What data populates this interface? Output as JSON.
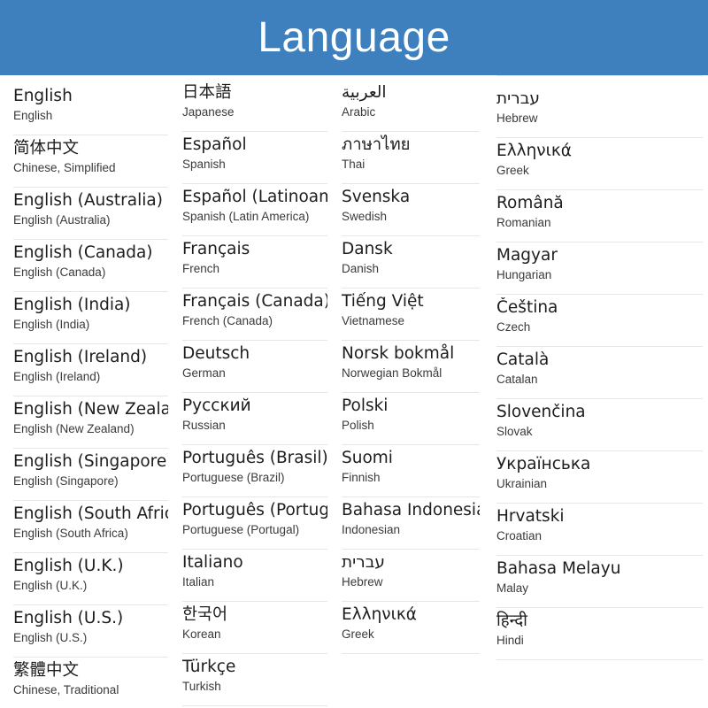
{
  "header": {
    "title": "Language",
    "background_color": "#3d80bd",
    "text_color": "#ffffff"
  },
  "theme": {
    "accent": "#3d80bd",
    "divider": "#e6e6e6",
    "native_text": "#1d1d1d",
    "english_text": "#3a3a3a",
    "page_background": "#ffffff"
  },
  "columns": [
    {
      "index": 0,
      "items": [
        {
          "native": "English",
          "english": "English"
        },
        {
          "native": "简体中文",
          "english": "Chinese, Simplified"
        },
        {
          "native": "English (Australia)",
          "english": "English (Australia)"
        },
        {
          "native": "English (Canada)",
          "english": "English (Canada)"
        },
        {
          "native": "English (India)",
          "english": "English (India)"
        },
        {
          "native": "English (Ireland)",
          "english": "English (Ireland)"
        },
        {
          "native": "English (New Zealand)",
          "english": "English (New Zealand)"
        },
        {
          "native": "English (Singapore)",
          "english": "English (Singapore)"
        },
        {
          "native": "English (South Africa)",
          "english": "English (South Africa)"
        },
        {
          "native": "English (U.K.)",
          "english": "English (U.K.)"
        },
        {
          "native": "English (U.S.)",
          "english": "English (U.S.)"
        },
        {
          "native": "繁體中文",
          "english": "Chinese, Traditional"
        }
      ]
    },
    {
      "index": 1,
      "items": [
        {
          "native": "日本語",
          "english": "Japanese"
        },
        {
          "native": "Español",
          "english": "Spanish"
        },
        {
          "native": "Español (Latinoamérica)",
          "english": "Spanish (Latin America)"
        },
        {
          "native": "Français",
          "english": "French"
        },
        {
          "native": "Français (Canada)",
          "english": "French (Canada)"
        },
        {
          "native": "Deutsch",
          "english": "German"
        },
        {
          "native": "Русский",
          "english": "Russian"
        },
        {
          "native": "Português (Brasil)",
          "english": "Portuguese (Brazil)"
        },
        {
          "native": "Português (Portugal)",
          "english": "Portuguese (Portugal)"
        },
        {
          "native": "Italiano",
          "english": "Italian"
        },
        {
          "native": "한국어",
          "english": "Korean"
        },
        {
          "native": "Türkçe",
          "english": "Turkish"
        }
      ]
    },
    {
      "index": 2,
      "items": [
        {
          "native": "العربية",
          "english": "Arabic"
        },
        {
          "native": "ภาษาไทย",
          "english": "Thai"
        },
        {
          "native": "Svenska",
          "english": "Swedish"
        },
        {
          "native": "Dansk",
          "english": "Danish"
        },
        {
          "native": "Tiếng Việt",
          "english": "Vietnamese"
        },
        {
          "native": "Norsk bokmål",
          "english": "Norwegian Bokmål"
        },
        {
          "native": "Polski",
          "english": "Polish"
        },
        {
          "native": "Suomi",
          "english": "Finnish"
        },
        {
          "native": "Bahasa Indonesia",
          "english": "Indonesian"
        },
        {
          "native": "עברית",
          "english": "Hebrew"
        },
        {
          "native": "Ελληνικά",
          "english": "Greek"
        }
      ]
    },
    {
      "index": 3,
      "items": [
        {
          "native": "עברית",
          "english": "Hebrew"
        },
        {
          "native": "Ελληνικά",
          "english": "Greek"
        },
        {
          "native": "Română",
          "english": "Romanian"
        },
        {
          "native": "Magyar",
          "english": "Hungarian"
        },
        {
          "native": "Čeština",
          "english": "Czech"
        },
        {
          "native": "Català",
          "english": "Catalan"
        },
        {
          "native": "Slovenčina",
          "english": "Slovak"
        },
        {
          "native": "Українська",
          "english": "Ukrainian"
        },
        {
          "native": "Hrvatski",
          "english": "Croatian"
        },
        {
          "native": "Bahasa Melayu",
          "english": "Malay"
        },
        {
          "native": "हिन्दी",
          "english": "Hindi"
        }
      ]
    }
  ]
}
